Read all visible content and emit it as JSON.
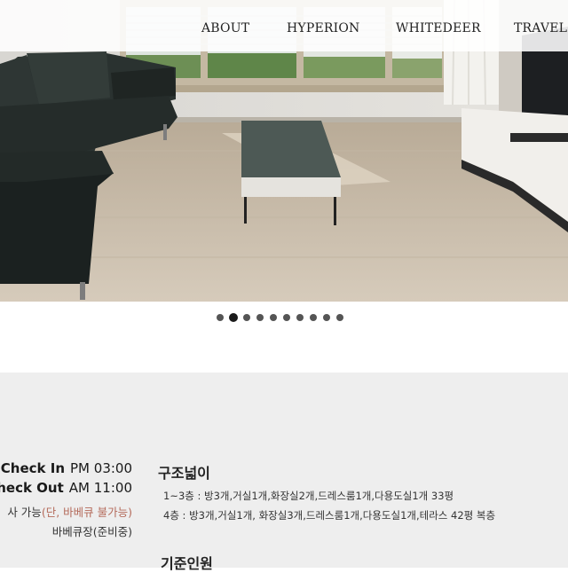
{
  "nav": {
    "items": [
      "ABOUT",
      "HYPERION",
      "WHITEDEER",
      "TRAVEL"
    ]
  },
  "hero": {
    "image": "living-room-with-sofa-coffee-table-tv-stand",
    "slide_count": 10,
    "active_slide": 2
  },
  "info": {
    "check_in_label": "Check In",
    "check_in_time": "PM 03:00",
    "check_out_label": "Check Out",
    "check_out_time": "AM 11:00",
    "bbq_note_prefix": "사 가능",
    "bbq_note_detail": "(단, 바베큐 불가능)",
    "bbq_area": "바베큐장(준비중)",
    "structure_title": "구조넓이",
    "structure_lines": [
      "1~3층 : 방3개,거실1개,화장실2개,드레스룸1개,다용도실1개 33평",
      "4층 : 방3개,거실1개, 화장실3개,드레스룸1개,다용도실1개,테라스 42평 복층"
    ],
    "capacity_title": "기준인원"
  },
  "colors": {
    "nav_bg": "#ffffff",
    "info_bg": "#eeeeee",
    "accent_note": "#b46a5a",
    "text": "#1a1a1a"
  }
}
